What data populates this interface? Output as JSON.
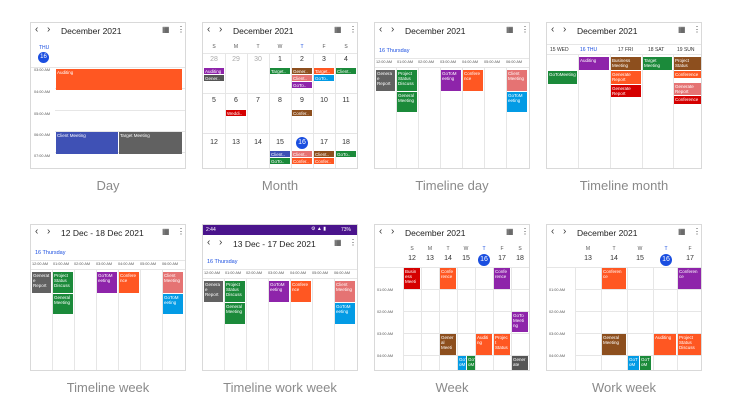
{
  "colors": {
    "accent": "#1a4ee0",
    "orange": "#ff5722",
    "blue": "#3f51b5",
    "gray": "#616161",
    "purple": "#8e24aa",
    "green": "#1b8a3a",
    "red": "#d50000",
    "brown": "#8d4f1e",
    "salmon": "#e57373",
    "cyan": "#039be5",
    "darkgray": "#555555"
  },
  "captions": [
    "Day",
    "Month",
    "Timeline day",
    "Timeline month",
    "Timeline week",
    "Timeline work week",
    "Week",
    "Work week"
  ],
  "day": {
    "title": "December 2021",
    "dow": "THU",
    "date": "16",
    "times": [
      "03:00 AM",
      "04:00 AM",
      "05:00 AM",
      "06:00 AM",
      "07:00 AM"
    ],
    "events": [
      "Auditing",
      "Client Meeting",
      "Target Meeting"
    ]
  },
  "month": {
    "title": "December 2021",
    "dows": [
      "S",
      "M",
      "T",
      "W",
      "T",
      "F",
      "S"
    ],
    "weeks": [
      [
        "28",
        "29",
        "30",
        "1",
        "2",
        "3",
        "4"
      ],
      [
        "5",
        "6",
        "7",
        "8",
        "9",
        "10",
        "11"
      ],
      [
        "12",
        "13",
        "14",
        "15",
        "16",
        "17",
        "18"
      ]
    ],
    "events": [
      "Auditing",
      "Gener..",
      "Target..",
      "Gener..",
      "Target..",
      "Client..",
      "Client..",
      "GoTo..",
      "GoTo..",
      "Weddi..",
      "Confer..",
      "Client..",
      "Client..",
      "GoTo..",
      "Confer..",
      "GoTo..",
      "Client..",
      "Confer.."
    ]
  },
  "tday": {
    "title": "December 2021",
    "subtitle": "16 Thursday",
    "times": [
      "12:00 AM",
      "01:00 AM",
      "02:00 AM",
      "03:00 AM",
      "04:00 AM",
      "05:00 AM",
      "06:00 AM"
    ],
    "events": [
      "Genera e Report",
      "Project Status Discuss",
      "General Meeting",
      "GoToM eeting",
      "Confere nce",
      "Client Meeting",
      "GoToM eeting"
    ]
  },
  "tmonth": {
    "title": "December 2021",
    "days": [
      "15 WED",
      "16 THU",
      "17 FRI",
      "18 SAT",
      "19 SUN"
    ],
    "events": [
      "GoToMeeting",
      "Auditing",
      "Business Meeting",
      "Target Meeting",
      "Project Status",
      "Generate Report",
      "Conference",
      "Generate Report",
      "Generate Report",
      "Conference"
    ]
  },
  "tweek": {
    "title": "12 Dec - 18 Dec 2021",
    "subtitle": "16 Thursday",
    "times": [
      "12:00 AM",
      "01:00 AM",
      "02:00 AM",
      "03:00 AM",
      "04:00 AM",
      "05:00 AM",
      "06:00 AM"
    ],
    "events": [
      "Generat e Report",
      "Project Status Discuss",
      "General Meeting",
      "GoToM eeting",
      "Confere nce",
      "Client Meeting",
      "GoToM eeting"
    ]
  },
  "twork": {
    "status_time": "2:44",
    "status_battery": "73%",
    "title": "13 Dec - 17 Dec 2021",
    "subtitle": "16 Thursday",
    "times": [
      "12:00 AM",
      "01:00 AM",
      "02:00 AM",
      "03:00 AM",
      "04:00 AM",
      "05:00 AM",
      "06:00 AM"
    ],
    "events": [
      "Genera e Report",
      "Project Status Discuss",
      "General Meeting",
      "GoToM eeting",
      "Confere nce",
      "Client Meeting",
      "GoToM eeting"
    ]
  },
  "week": {
    "title": "December 2021",
    "dows": [
      "S",
      "M",
      "T",
      "W",
      "T",
      "F",
      "S"
    ],
    "dates": [
      "12",
      "13",
      "14",
      "15",
      "16",
      "17",
      "18"
    ],
    "times": [
      "01:00 AM",
      "02:00 AM",
      "03:00 AM",
      "04:00 AM"
    ],
    "events": [
      "Busin ess Meeti",
      "Confe rence",
      "Confe rence",
      "GoTo Meeti ng",
      "Gener al Meeti",
      "Auditi ng",
      "Projec t Status",
      "Gener ate",
      "GoT oM",
      "GoT oM"
    ]
  },
  "workweek": {
    "title": "December 2021",
    "dows": [
      "M",
      "T",
      "W",
      "T",
      "F"
    ],
    "dates": [
      "13",
      "14",
      "15",
      "16",
      "17"
    ],
    "times": [
      "01:00 AM",
      "02:00 AM",
      "03:00 AM",
      "04:00 AM"
    ],
    "events": [
      "Conferen ce",
      "Conferen ce",
      "General Meeting",
      "Auditing",
      "Project Status Discuss",
      "GoT oM",
      "GoT oM"
    ]
  }
}
